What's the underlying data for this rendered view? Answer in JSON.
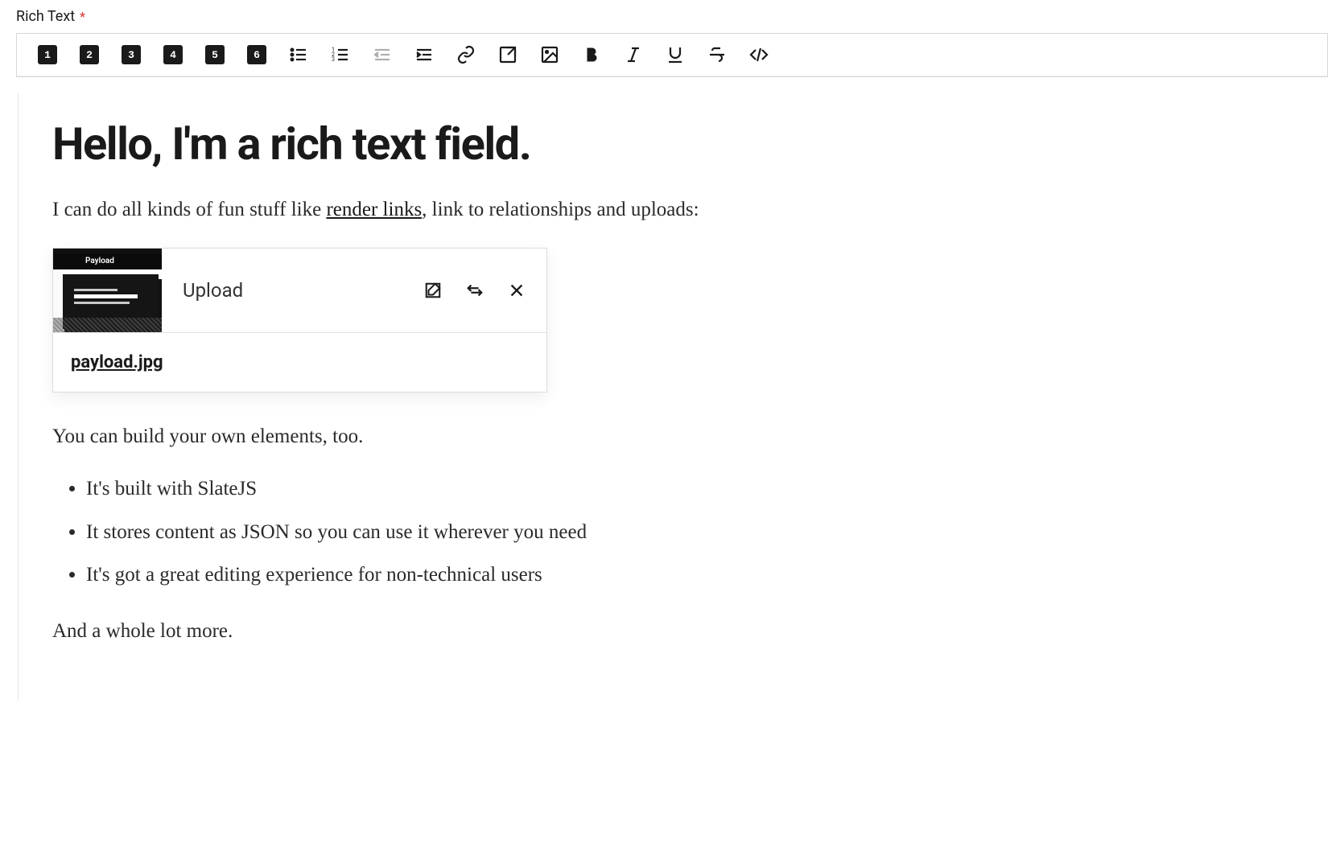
{
  "field": {
    "label": "Rich Text",
    "required": "*"
  },
  "toolbar": {
    "headings": [
      "1",
      "2",
      "3",
      "4",
      "5",
      "6"
    ]
  },
  "content": {
    "heading": "Hello, I'm a rich text field.",
    "para1_pre": "I can do all kinds of fun stuff like ",
    "para1_link": "render links",
    "para1_post": ", link to relationships and uploads:",
    "upload": {
      "label": "Upload",
      "filename": "payload.jpg",
      "thumb_logo": "Payload"
    },
    "para2": "You can build your own elements, too.",
    "bullets": [
      "It's built with SlateJS",
      "It stores content as JSON so you can use it wherever you need",
      "It's got a great editing experience for non-technical users"
    ],
    "para3": "And a whole lot more."
  }
}
